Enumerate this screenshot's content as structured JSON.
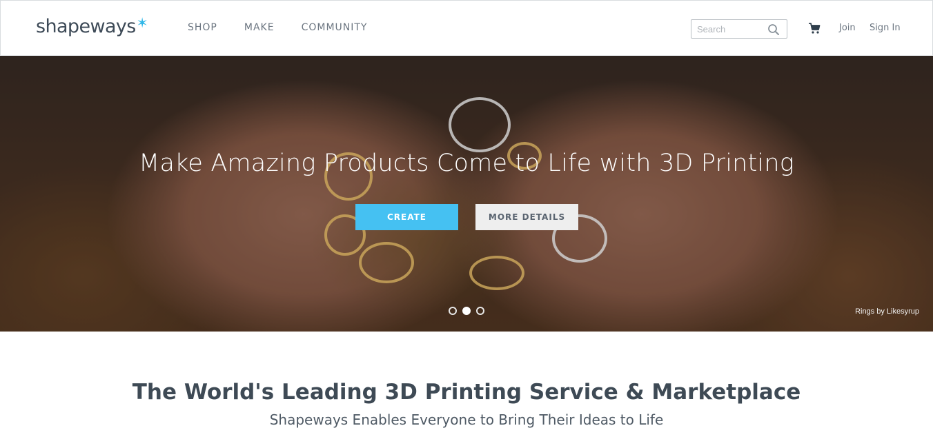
{
  "header": {
    "logo_text": "shapeways",
    "logo_star": "✶",
    "nav": [
      "SHOP",
      "MAKE",
      "COMMUNITY"
    ],
    "search_placeholder": "Search",
    "join_label": "Join",
    "signin_label": "Sign In"
  },
  "hero": {
    "title": "Make Amazing Products Come to Life with 3D Printing",
    "create_label": "CREATE",
    "details_label": "MORE DETAILS",
    "credit": "Rings by Likesyrup",
    "slides_total": 3,
    "active_slide": 2
  },
  "section": {
    "headline": "The World's Leading 3D Printing Service & Marketplace",
    "subhead": "Shapeways Enables Everyone to Bring Their Ideas to Life"
  },
  "colors": {
    "accent": "#45c1f2",
    "logo_star": "#2fb7e8",
    "text_dark": "#3e4a55"
  },
  "icons": [
    "search-icon",
    "cart-icon"
  ]
}
